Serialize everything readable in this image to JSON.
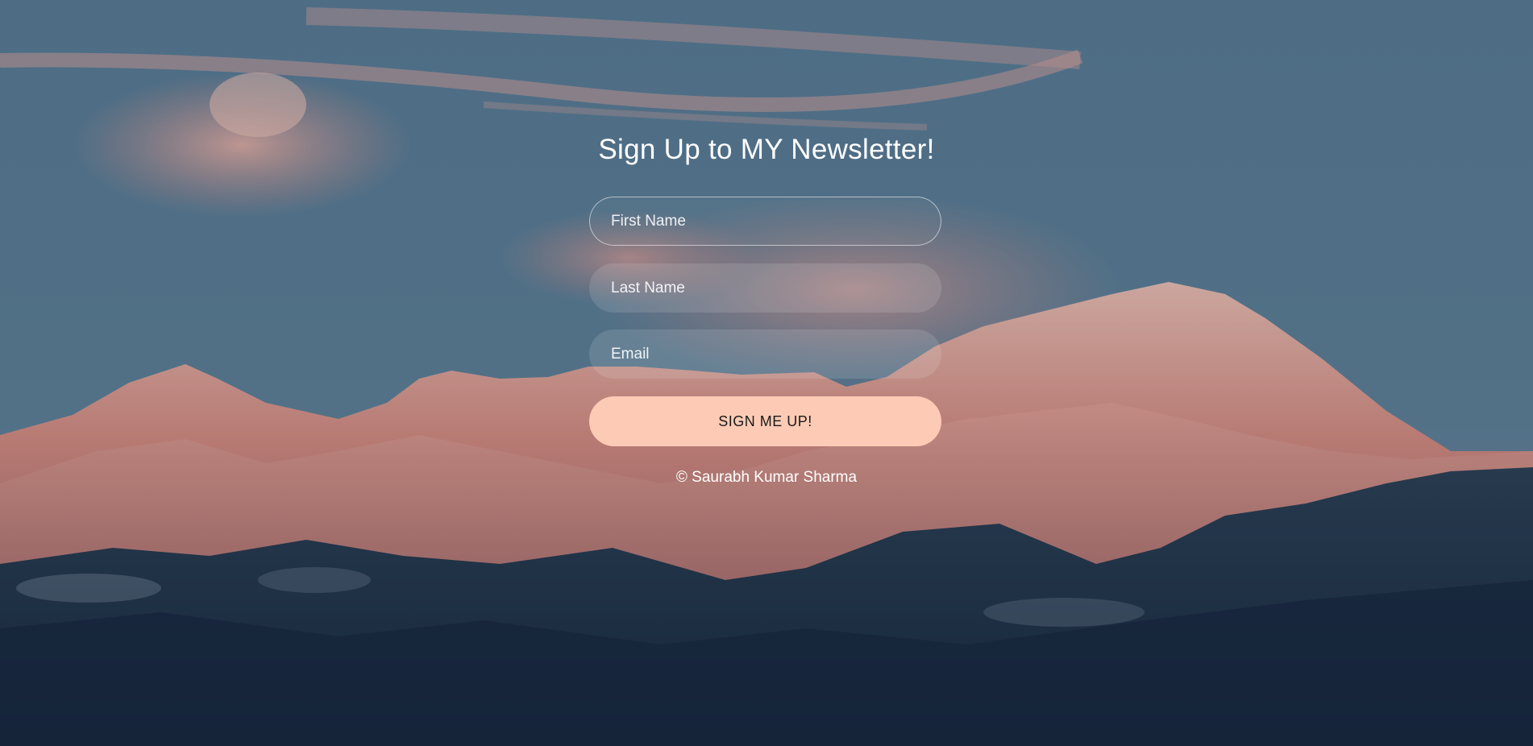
{
  "form": {
    "title": "Sign Up to MY Newsletter!",
    "first_name_placeholder": "First Name",
    "last_name_placeholder": "Last Name",
    "email_placeholder": "Email",
    "submit_label": "SIGN ME UP!"
  },
  "footer": {
    "copyright": "© Saurabh Kumar Sharma"
  },
  "colors": {
    "button_bg": "#fdcbb5",
    "sky": "#5b7d96",
    "peaks_pink": "#e08f85",
    "foothills_dark": "#1f3347"
  }
}
